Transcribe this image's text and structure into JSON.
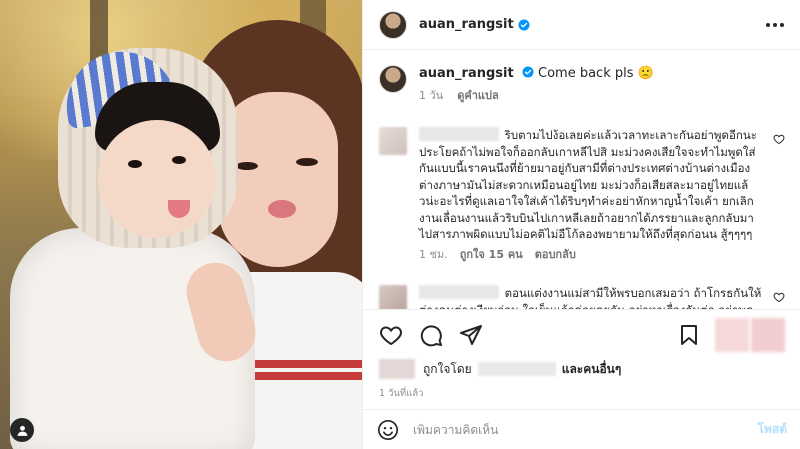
{
  "post": {
    "username": "auan_rangsit",
    "caption_text": "Come back pls 🙁",
    "caption_age": "1 วัน",
    "translate_label": "ดูคำแปล"
  },
  "comments": [
    {
      "text": "ริบตามไปง้อเลยค่ะแล้วเวลาทะเลาะกันอย่าพูดอีกนะ ประโยคถ้าไม่พอใจก็ออกลับเกาหลีไปสิ มะม่วงคงเสียใจจะทำไมพูดใส่กันแบบนี้เราคนนึงที่ย้ายมาอยู่กับสามีที่ต่างประเทศต่างบ้านต่างเมืองต่างภาษามันไม่สะดวกเหมือนอยู่ไทย มะม่วงก็อเสียสละมาอยู่ไทยแล้วน่ะอะไรที่ดูแลเอาใจใส่เค้าได้ริบๆทำค่ะอย่าหักหาญน้ำใจเค้า ยกเลิกงานเลื่อนงานแล้วริบบินไปเกาหลีเลยถ้าอยากได้ภรรยาและลูกกลับมาไปสารภาพผิดแบบไม่อคติไม่อีโก้ลองพยายามให้ถึงที่สุดก่อนน สู้ๆๆๆๆ",
      "age": "1 ชม.",
      "likes": "ถูกใจ 15 คน",
      "reply": "ตอบกลับ"
    },
    {
      "text": "ตอนแต่งงานแม่สามีให้พรบอกเสมอว่า ถ้าโกรธกันให้ต่างคนต่างเงียบก่อน ใจเย็นแล้วค่อยคุยกัน อย่าหาเรื่องกันต่อ อย่าพูดใส่ใจให้",
      "age": "",
      "likes": "",
      "reply": ""
    }
  ],
  "likes_line": {
    "prefix": "ถูกใจโดย",
    "suffix": "และคนอื่นๆ"
  },
  "time_ago": "1 วันที่แล้ว",
  "composer": {
    "placeholder": "เพิ่มความคิดเห็น",
    "post_label": "โพสต์"
  },
  "icons": {
    "actions": [
      "heart-icon",
      "comment-icon",
      "share-icon",
      "bookmark-icon"
    ],
    "composer": "emoji-icon",
    "photo": "user-tag-icon"
  },
  "colors": {
    "verified": "#0095f6",
    "post_button": "#b2dffc",
    "secondary_text": "#8e8e8e"
  }
}
